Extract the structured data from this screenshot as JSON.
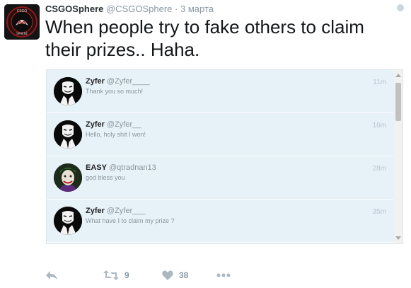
{
  "tweet": {
    "author_name": "CSGOSphere",
    "author_handle": "@CSGOSphere",
    "separator": "·",
    "date": "3 марта",
    "text": "When people try to fake others to claim their prizes.. Haha.",
    "avatar_lettering": [
      "CSGO",
      "SPHERE"
    ]
  },
  "replies": [
    {
      "name": "Zyfer",
      "handle": "@Zyfer____",
      "text": "Thank you so much!",
      "time": "11m",
      "avatar": "anonymous-mask"
    },
    {
      "name": "Zyfer",
      "handle": "@Zyfer__",
      "text": "Hello, holy shit I won!",
      "time": "16m",
      "avatar": "anonymous-mask"
    },
    {
      "name": "EASY",
      "handle": "@qtradnan13",
      "text": "god bless you",
      "time": "28m",
      "avatar": "joker"
    },
    {
      "name": "Zyfer",
      "handle": "@Zyfer___",
      "text": "What have I to claim my prize ?",
      "time": "35m",
      "avatar": "anonymous-mask"
    }
  ],
  "actions": {
    "reply_icon": "reply-arrow-icon",
    "retweet_icon": "retweet-icon",
    "retweet_count": "9",
    "like_icon": "heart-icon",
    "like_count": "38",
    "more_icon": "more-dots-icon"
  },
  "colors": {
    "media_background": "#e6f1f8",
    "icon_gray": "#aab8c2",
    "meta_gray": "#8899a6",
    "text": "#14171a"
  }
}
